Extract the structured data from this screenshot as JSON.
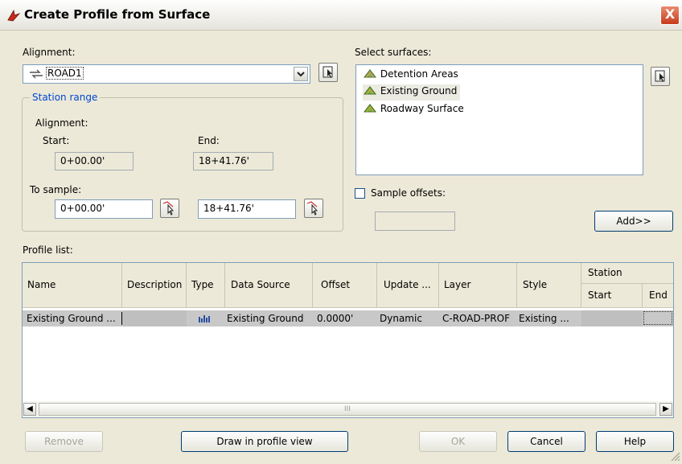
{
  "dialog": {
    "title": "Create Profile from Surface",
    "close_glyph": "X"
  },
  "alignment": {
    "label": "Alignment:",
    "value": "ROAD1"
  },
  "station_range": {
    "title": "Station range",
    "alignment_label": "Alignment:",
    "start_label": "Start:",
    "end_label": "End:",
    "start_value": "0+00.00'",
    "end_value": "18+41.76'",
    "to_sample_label": "To sample:",
    "sample_start": "0+00.00'",
    "sample_end": "18+41.76'"
  },
  "surfaces": {
    "label": "Select surfaces:",
    "items": [
      "Detention Areas",
      "Existing Ground",
      "Roadway Surface"
    ],
    "selected": "Existing Ground"
  },
  "sample_offsets": {
    "label": "Sample offsets:",
    "checked": false
  },
  "add_button": "Add>>",
  "profile_list": {
    "label": "Profile list:",
    "columns": [
      "Name",
      "Description",
      "Type",
      "Data Source",
      "Offset",
      "Update ...",
      "Layer",
      "Style"
    ],
    "station_group": "Station",
    "station_columns": [
      "Start",
      "End"
    ],
    "rows": [
      {
        "name": "Existing Ground ...",
        "description": "",
        "type_icon": "profile-type-icon",
        "data_source": "Existing Ground",
        "offset": "0.0000'",
        "update": "Dynamic",
        "layer": "C-ROAD-PROF",
        "style": "Existing ...",
        "start": "",
        "end": ""
      }
    ],
    "scroll_grip": "III"
  },
  "buttons": {
    "remove": "Remove",
    "draw": "Draw in profile view",
    "ok": "OK",
    "cancel": "Cancel",
    "help": "Help"
  },
  "colors": {
    "group_title": "#0046d5",
    "selection": "#c8c8c8"
  }
}
